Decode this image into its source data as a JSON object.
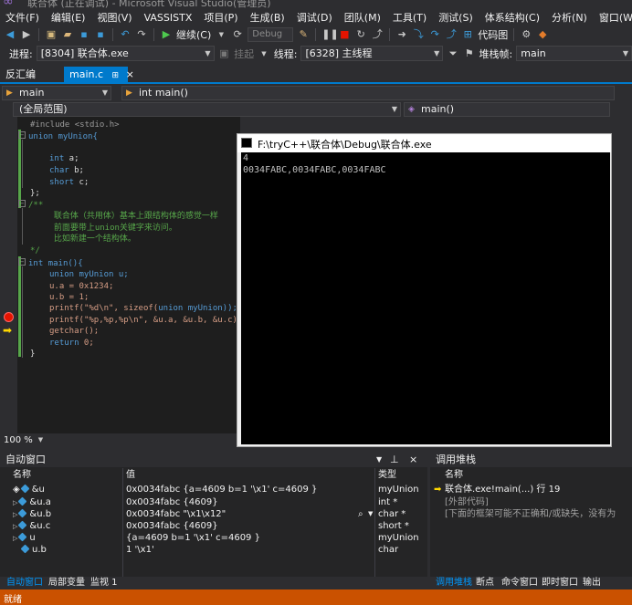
{
  "window": {
    "title": "联合体 (正在调试) - Microsoft Visual Studio(管理员)"
  },
  "menu": [
    "文件(F)",
    "编辑(E)",
    "视图(V)",
    "VASSISTX",
    "项目(P)",
    "生成(B)",
    "调试(D)",
    "团队(M)",
    "工具(T)",
    "测试(S)",
    "体系结构(C)",
    "分析(N)",
    "窗口(W)",
    "帮"
  ],
  "toolbar": {
    "continue_label": "继续(C)",
    "config": "Debug",
    "code_map": "代码图"
  },
  "debugbar": {
    "process_label": "进程:",
    "process_value": "[8304] 联合体.exe",
    "lifecycle_label": "挂起",
    "thread_label": "线程:",
    "thread_value": "[6328] 主线程",
    "stack_label": "堆栈帧:",
    "stack_value": "main"
  },
  "tabs": {
    "disasm": "反汇编",
    "mainc": "main.c",
    "pin": "⊞",
    "close": "×"
  },
  "nav": {
    "scope": "main",
    "member": "int main()",
    "global": "(全局范围)",
    "func": "main()"
  },
  "code": {
    "l1": "#include <stdio.h>",
    "l2a": "union",
    "l2b": " myUnion{",
    "l3a": "int",
    "l3b": " a;",
    "l4a": "char",
    "l4b": " b;",
    "l5a": "short",
    "l5b": " c;",
    "l6": "};",
    "l7": "/**",
    "l8": "  联合体（共用体）基本上跟结构体的感觉一样",
    "l9": "  前面要带上union关键字来访问。",
    "l10": "  比如新建一个结构体。",
    "l11": "*/",
    "l12a": "int",
    "l12b": " main(){",
    "l13a": "union",
    "l13b": " myUnion u;",
    "l14": "u.a = 0x1234;",
    "l15": "u.b = 1;",
    "l16a": "printf(",
    "l16b": "\"%d\\n\"",
    "l16c": ", sizeof(",
    "l16d": "union",
    "l16e": " myUnion));",
    "l17a": "printf(",
    "l17b": "\"%p,%p,%p\\n\"",
    "l17c": ", &u.a, &u.b, &u.c);",
    "l18": "getchar();",
    "l19a": "return",
    "l19b": " 0;",
    "l20": "}"
  },
  "zoom": "100 %",
  "console": {
    "title": "F:\\tryC++\\联合体\\Debug\\联合体.exe",
    "lines": [
      "4",
      "0034FABC,0034FABC,0034FABC"
    ]
  },
  "autos": {
    "header": "自动窗口",
    "col_name": "名称",
    "col_value": "值",
    "col_type": "类型",
    "rows": [
      {
        "name": "&u",
        "value": "0x0034fabc {a=4609 b=1 '\\x1' c=4609 }",
        "type": "myUnion"
      },
      {
        "name": "&u.a",
        "value": "0x0034fabc {4609}",
        "type": "int *"
      },
      {
        "name": "&u.b",
        "value": "0x0034fabc \"\\x1\\x12\"",
        "type": "char *"
      },
      {
        "name": "&u.c",
        "value": "0x0034fabc {4609}",
        "type": "short *"
      },
      {
        "name": "u",
        "value": "{a=4609 b=1 '\\x1' c=4609 }",
        "type": "myUnion"
      },
      {
        "name": "u.b",
        "value": "1 '\\x1'",
        "type": "char"
      }
    ],
    "tabs": [
      "自动窗口",
      "局部变量",
      "监视 1"
    ]
  },
  "callstack": {
    "header": "调用堆栈",
    "col_name": "名称",
    "rows": [
      "联合体.exe!main(...) 行 19",
      "[外部代码]",
      "[下面的框架可能不正确和/或缺失，没有为"
    ],
    "tabs": [
      "调用堆栈",
      "断点",
      "命令窗口",
      "即时窗口",
      "输出"
    ]
  },
  "status": {
    "text": "就绪"
  },
  "colors": {
    "accent": "#007acc",
    "status": "#ca5100",
    "breakpoint": "#e51400"
  }
}
